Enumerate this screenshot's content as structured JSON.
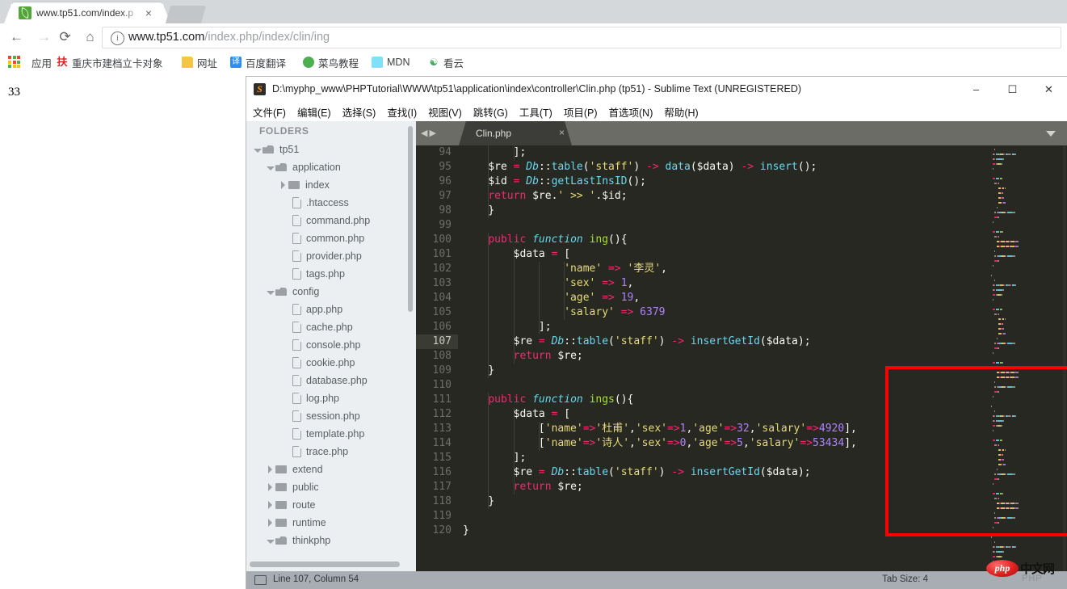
{
  "browser": {
    "tab": {
      "title": "www.tp51.com/index.p",
      "close": "×",
      "favicon": "leaf-icon"
    },
    "nav": {
      "back": "←",
      "forward": "→",
      "reload": "⟳",
      "home": "⌂"
    },
    "omnibox": {
      "info": "i",
      "url_bold": "www.tp51.com",
      "url_rest": "/index.php/index/clin/ing"
    },
    "bookmarks": [
      {
        "label": "应用",
        "icon": "apps-grid-icon"
      },
      {
        "label": "重庆市建档立卡对象",
        "icon": "fu-icon"
      },
      {
        "label": "网址",
        "icon": "folder-icon"
      },
      {
        "label": "百度翻译",
        "icon": "translate-icon"
      },
      {
        "label": "菜鸟教程",
        "icon": "runoob-icon"
      },
      {
        "label": "MDN",
        "icon": "mdn-icon"
      },
      {
        "label": "看云",
        "icon": "kanyun-icon"
      }
    ],
    "page_content": "33"
  },
  "sublime": {
    "title": "D:\\myphp_www\\PHPTutorial\\WWW\\tp51\\application\\index\\controller\\Clin.php (tp51) - Sublime Text (UNREGISTERED)",
    "window_buttons": {
      "minimize": "–",
      "maximize": "☐",
      "close": "✕"
    },
    "menu": [
      "文件(F)",
      "编辑(E)",
      "选择(S)",
      "查找(I)",
      "视图(V)",
      "跳转(G)",
      "工具(T)",
      "项目(P)",
      "首选项(N)",
      "帮助(H)"
    ],
    "sidebar": {
      "header": "FOLDERS",
      "items": [
        {
          "label": "tp51",
          "type": "folder",
          "state": "open",
          "depth": 0
        },
        {
          "label": "application",
          "type": "folder",
          "state": "open",
          "depth": 1
        },
        {
          "label": "index",
          "type": "folder",
          "state": "closed",
          "depth": 2
        },
        {
          "label": ".htaccess",
          "type": "file",
          "state": "",
          "depth": 3
        },
        {
          "label": "command.php",
          "type": "file",
          "state": "",
          "depth": 3
        },
        {
          "label": "common.php",
          "type": "file",
          "state": "",
          "depth": 3
        },
        {
          "label": "provider.php",
          "type": "file",
          "state": "",
          "depth": 3
        },
        {
          "label": "tags.php",
          "type": "file",
          "state": "",
          "depth": 3
        },
        {
          "label": "config",
          "type": "folder",
          "state": "open",
          "depth": 1
        },
        {
          "label": "app.php",
          "type": "file",
          "state": "",
          "depth": 3
        },
        {
          "label": "cache.php",
          "type": "file",
          "state": "",
          "depth": 3
        },
        {
          "label": "console.php",
          "type": "file",
          "state": "",
          "depth": 3
        },
        {
          "label": "cookie.php",
          "type": "file",
          "state": "",
          "depth": 3
        },
        {
          "label": "database.php",
          "type": "file",
          "state": "",
          "depth": 3
        },
        {
          "label": "log.php",
          "type": "file",
          "state": "",
          "depth": 3
        },
        {
          "label": "session.php",
          "type": "file",
          "state": "",
          "depth": 3
        },
        {
          "label": "template.php",
          "type": "file",
          "state": "",
          "depth": 3
        },
        {
          "label": "trace.php",
          "type": "file",
          "state": "",
          "depth": 3
        },
        {
          "label": "extend",
          "type": "folder",
          "state": "closed",
          "depth": 1
        },
        {
          "label": "public",
          "type": "folder",
          "state": "closed",
          "depth": 1
        },
        {
          "label": "route",
          "type": "folder",
          "state": "closed",
          "depth": 1
        },
        {
          "label": "runtime",
          "type": "folder",
          "state": "closed",
          "depth": 1
        },
        {
          "label": "thinkphp",
          "type": "folder",
          "state": "open",
          "depth": 1
        }
      ]
    },
    "editor": {
      "nav_arrows": "◀▶",
      "tab": {
        "label": "Clin.php",
        "close": "×"
      },
      "tab_dropdown": "chevron-down-icon",
      "first_line": 94,
      "current_line": 107,
      "lines": [
        {
          "n": 94,
          "tokens": [
            {
              "t": "        ];",
              "c": "pl"
            }
          ]
        },
        {
          "n": 95,
          "tokens": [
            {
              "t": "    ",
              "c": "pl"
            },
            {
              "t": "$re",
              "c": "pl"
            },
            {
              "t": " = ",
              "c": "op"
            },
            {
              "t": "Db",
              "c": "kw"
            },
            {
              "t": "::",
              "c": "pl"
            },
            {
              "t": "table",
              "c": "m"
            },
            {
              "t": "(",
              "c": "pl"
            },
            {
              "t": "'staff'",
              "c": "str"
            },
            {
              "t": ") ",
              "c": "pl"
            },
            {
              "t": "->",
              "c": "op"
            },
            {
              "t": " ",
              "c": "pl"
            },
            {
              "t": "data",
              "c": "m"
            },
            {
              "t": "($data) ",
              "c": "pl"
            },
            {
              "t": "->",
              "c": "op"
            },
            {
              "t": " ",
              "c": "pl"
            },
            {
              "t": "insert",
              "c": "m"
            },
            {
              "t": "();",
              "c": "pl"
            }
          ]
        },
        {
          "n": 96,
          "tokens": [
            {
              "t": "    ",
              "c": "pl"
            },
            {
              "t": "$id",
              "c": "pl"
            },
            {
              "t": " = ",
              "c": "op"
            },
            {
              "t": "Db",
              "c": "kw"
            },
            {
              "t": "::",
              "c": "pl"
            },
            {
              "t": "getLastInsID",
              "c": "m"
            },
            {
              "t": "();",
              "c": "pl"
            }
          ]
        },
        {
          "n": 97,
          "tokens": [
            {
              "t": "    ",
              "c": "pl"
            },
            {
              "t": "return",
              "c": "k"
            },
            {
              "t": " $re.",
              "c": "pl"
            },
            {
              "t": "' >> '",
              "c": "str"
            },
            {
              "t": ".$id;",
              "c": "pl"
            }
          ]
        },
        {
          "n": 98,
          "tokens": [
            {
              "t": "    }",
              "c": "pl"
            }
          ]
        },
        {
          "n": 99,
          "tokens": [
            {
              "t": "",
              "c": "pl"
            }
          ]
        },
        {
          "n": 100,
          "tokens": [
            {
              "t": "    ",
              "c": "pl"
            },
            {
              "t": "public",
              "c": "k"
            },
            {
              "t": " ",
              "c": "pl"
            },
            {
              "t": "function",
              "c": "kw"
            },
            {
              "t": " ",
              "c": "pl"
            },
            {
              "t": "ing",
              "c": "fn"
            },
            {
              "t": "(){",
              "c": "pl"
            }
          ]
        },
        {
          "n": 101,
          "tokens": [
            {
              "t": "        ",
              "c": "pl"
            },
            {
              "t": "$data",
              "c": "pl"
            },
            {
              "t": " = ",
              "c": "op"
            },
            {
              "t": "[",
              "c": "pl"
            }
          ]
        },
        {
          "n": 102,
          "tokens": [
            {
              "t": "                ",
              "c": "pl"
            },
            {
              "t": "'name'",
              "c": "str"
            },
            {
              "t": " => ",
              "c": "op"
            },
            {
              "t": "'李灵'",
              "c": "str"
            },
            {
              "t": ",",
              "c": "pl"
            }
          ]
        },
        {
          "n": 103,
          "tokens": [
            {
              "t": "                ",
              "c": "pl"
            },
            {
              "t": "'sex'",
              "c": "str"
            },
            {
              "t": " => ",
              "c": "op"
            },
            {
              "t": "1",
              "c": "num2"
            },
            {
              "t": ",",
              "c": "pl"
            }
          ]
        },
        {
          "n": 104,
          "tokens": [
            {
              "t": "                ",
              "c": "pl"
            },
            {
              "t": "'age'",
              "c": "str"
            },
            {
              "t": " => ",
              "c": "op"
            },
            {
              "t": "19",
              "c": "num2"
            },
            {
              "t": ",",
              "c": "pl"
            }
          ]
        },
        {
          "n": 105,
          "tokens": [
            {
              "t": "                ",
              "c": "pl"
            },
            {
              "t": "'salary'",
              "c": "str"
            },
            {
              "t": " => ",
              "c": "op"
            },
            {
              "t": "6379",
              "c": "num2"
            }
          ]
        },
        {
          "n": 106,
          "tokens": [
            {
              "t": "            ];",
              "c": "pl"
            }
          ]
        },
        {
          "n": 107,
          "tokens": [
            {
              "t": "        ",
              "c": "pl"
            },
            {
              "t": "$re",
              "c": "pl"
            },
            {
              "t": " = ",
              "c": "op"
            },
            {
              "t": "Db",
              "c": "kw"
            },
            {
              "t": "::",
              "c": "pl"
            },
            {
              "t": "table",
              "c": "m"
            },
            {
              "t": "(",
              "c": "pl"
            },
            {
              "t": "'staff'",
              "c": "str"
            },
            {
              "t": ") ",
              "c": "pl"
            },
            {
              "t": "->",
              "c": "op"
            },
            {
              "t": " ",
              "c": "pl"
            },
            {
              "t": "insertGetId",
              "c": "m"
            },
            {
              "t": "($data);",
              "c": "pl"
            }
          ]
        },
        {
          "n": 108,
          "tokens": [
            {
              "t": "        ",
              "c": "pl"
            },
            {
              "t": "return",
              "c": "k"
            },
            {
              "t": " $re;",
              "c": "pl"
            }
          ]
        },
        {
          "n": 109,
          "tokens": [
            {
              "t": "    }",
              "c": "pl"
            }
          ]
        },
        {
          "n": 110,
          "tokens": [
            {
              "t": "",
              "c": "pl"
            }
          ]
        },
        {
          "n": 111,
          "tokens": [
            {
              "t": "    ",
              "c": "pl"
            },
            {
              "t": "public",
              "c": "k"
            },
            {
              "t": " ",
              "c": "pl"
            },
            {
              "t": "function",
              "c": "kw"
            },
            {
              "t": " ",
              "c": "pl"
            },
            {
              "t": "ings",
              "c": "fn"
            },
            {
              "t": "(){",
              "c": "pl"
            }
          ]
        },
        {
          "n": 112,
          "tokens": [
            {
              "t": "        ",
              "c": "pl"
            },
            {
              "t": "$data",
              "c": "pl"
            },
            {
              "t": " = ",
              "c": "op"
            },
            {
              "t": "[",
              "c": "pl"
            }
          ]
        },
        {
          "n": 113,
          "tokens": [
            {
              "t": "            [",
              "c": "pl"
            },
            {
              "t": "'name'",
              "c": "str"
            },
            {
              "t": "=>",
              "c": "op"
            },
            {
              "t": "'杜甫'",
              "c": "str"
            },
            {
              "t": ",",
              "c": "pl"
            },
            {
              "t": "'sex'",
              "c": "str"
            },
            {
              "t": "=>",
              "c": "op"
            },
            {
              "t": "1",
              "c": "num2"
            },
            {
              "t": ",",
              "c": "pl"
            },
            {
              "t": "'age'",
              "c": "str"
            },
            {
              "t": "=>",
              "c": "op"
            },
            {
              "t": "32",
              "c": "num2"
            },
            {
              "t": ",",
              "c": "pl"
            },
            {
              "t": "'salary'",
              "c": "str"
            },
            {
              "t": "=>",
              "c": "op"
            },
            {
              "t": "4920",
              "c": "num2"
            },
            {
              "t": "],",
              "c": "pl"
            }
          ]
        },
        {
          "n": 114,
          "tokens": [
            {
              "t": "            [",
              "c": "pl"
            },
            {
              "t": "'name'",
              "c": "str"
            },
            {
              "t": "=>",
              "c": "op"
            },
            {
              "t": "'诗人'",
              "c": "str"
            },
            {
              "t": ",",
              "c": "pl"
            },
            {
              "t": "'sex'",
              "c": "str"
            },
            {
              "t": "=>",
              "c": "op"
            },
            {
              "t": "0",
              "c": "num2"
            },
            {
              "t": ",",
              "c": "pl"
            },
            {
              "t": "'age'",
              "c": "str"
            },
            {
              "t": "=>",
              "c": "op"
            },
            {
              "t": "5",
              "c": "num2"
            },
            {
              "t": ",",
              "c": "pl"
            },
            {
              "t": "'salary'",
              "c": "str"
            },
            {
              "t": "=>",
              "c": "op"
            },
            {
              "t": "53434",
              "c": "num2"
            },
            {
              "t": "],",
              "c": "pl"
            }
          ]
        },
        {
          "n": 115,
          "tokens": [
            {
              "t": "        ];",
              "c": "pl"
            }
          ]
        },
        {
          "n": 116,
          "tokens": [
            {
              "t": "        ",
              "c": "pl"
            },
            {
              "t": "$re",
              "c": "pl"
            },
            {
              "t": " = ",
              "c": "op"
            },
            {
              "t": "Db",
              "c": "kw"
            },
            {
              "t": "::",
              "c": "pl"
            },
            {
              "t": "table",
              "c": "m"
            },
            {
              "t": "(",
              "c": "pl"
            },
            {
              "t": "'staff'",
              "c": "str"
            },
            {
              "t": ") ",
              "c": "pl"
            },
            {
              "t": "->",
              "c": "op"
            },
            {
              "t": " ",
              "c": "pl"
            },
            {
              "t": "insertGetId",
              "c": "m"
            },
            {
              "t": "($data);",
              "c": "pl"
            }
          ]
        },
        {
          "n": 117,
          "tokens": [
            {
              "t": "        ",
              "c": "pl"
            },
            {
              "t": "return",
              "c": "k"
            },
            {
              "t": " $re;",
              "c": "pl"
            }
          ]
        },
        {
          "n": 118,
          "tokens": [
            {
              "t": "    }",
              "c": "pl"
            }
          ]
        },
        {
          "n": 119,
          "tokens": [
            {
              "t": "",
              "c": "pl"
            }
          ]
        },
        {
          "n": 120,
          "tokens": [
            {
              "t": "}",
              "c": "pl"
            }
          ]
        }
      ]
    },
    "status": {
      "position": "Line 107, Column 54",
      "tab_size": "Tab Size: 4"
    }
  },
  "watermark": {
    "logo": "php",
    "cn": "中文网",
    "sub": "PHP"
  },
  "colors": {
    "editor_bg": "#272822",
    "keyword": "#f92672",
    "string": "#e6db74",
    "number": "#ae81ff",
    "function": "#a6e22e",
    "type": "#66d9ef",
    "highlight_box": "#ff0000"
  }
}
